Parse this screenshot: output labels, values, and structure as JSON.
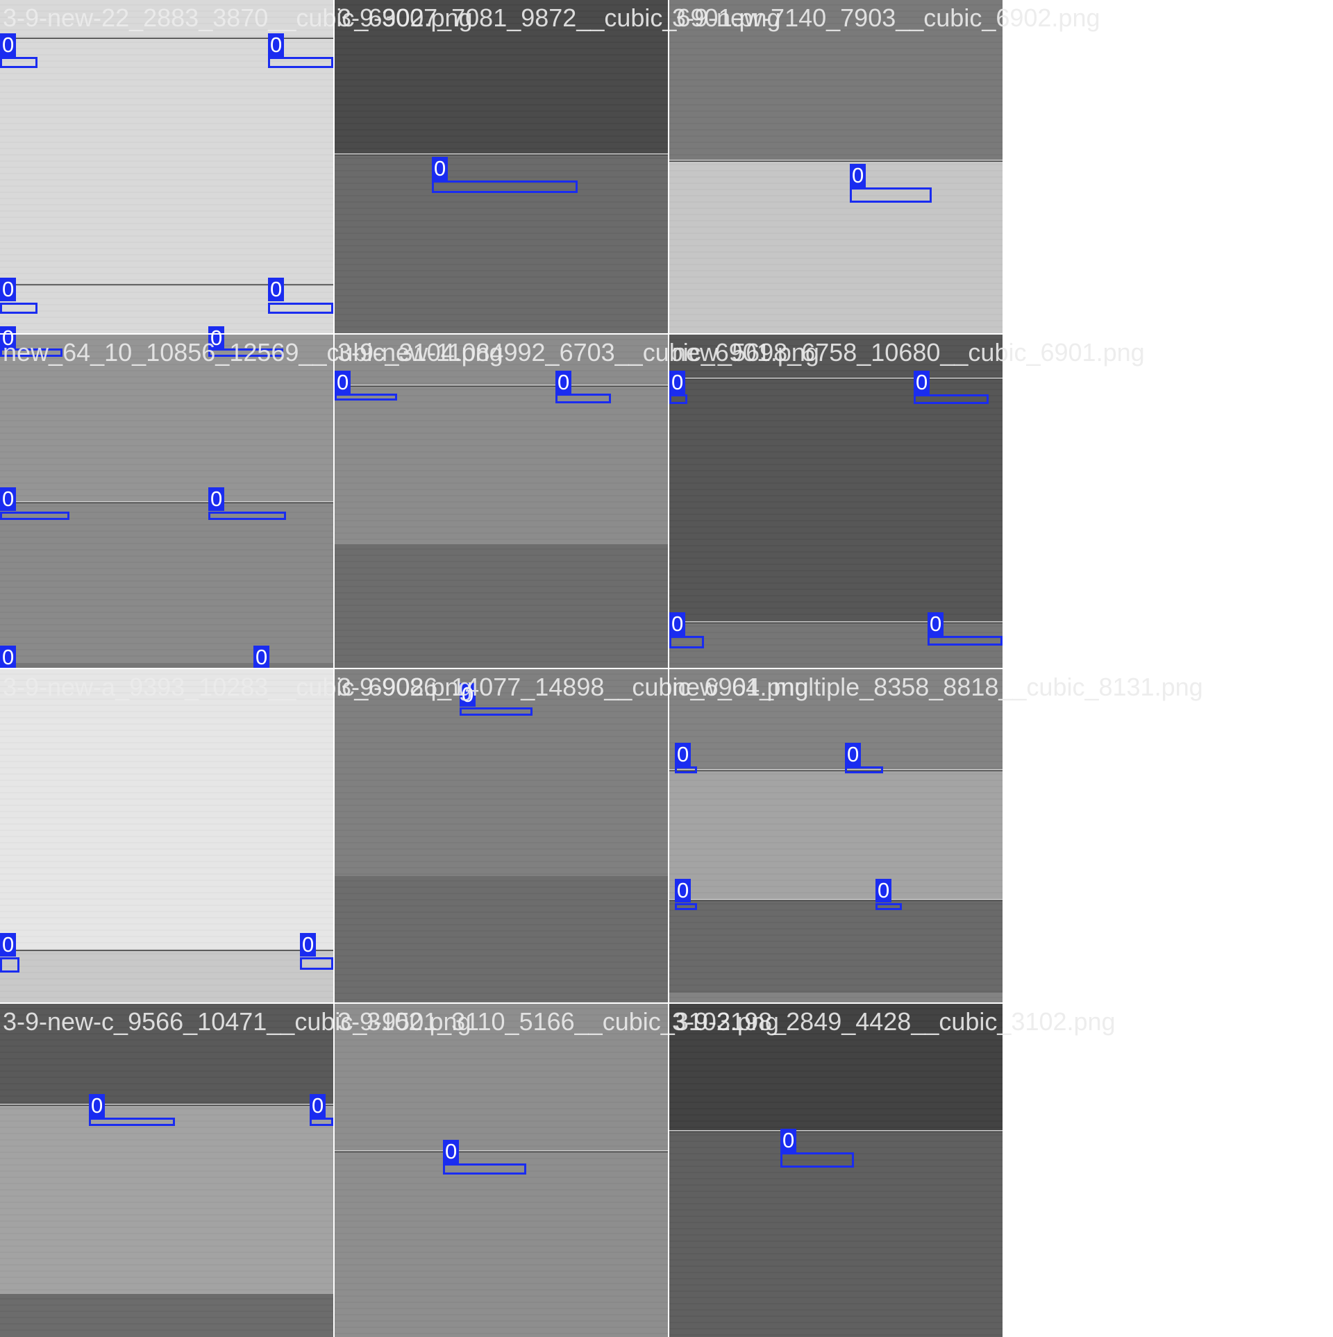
{
  "tiles": [
    {
      "file_label": "3-9-new-22_2883_3870__cubic_6902.png",
      "bands": [
        {
          "from": 0,
          "to": 1,
          "color": "#d9d9d9"
        }
      ],
      "edges": [
        0.11,
        0.85
      ],
      "class_labels": [
        "0",
        "0",
        "0",
        "0"
      ]
    },
    {
      "file_label": "3-9-3007_7081_9872__cubic_6901.png",
      "bands": [
        {
          "from": 0,
          "to": 0.46,
          "color": "#4b4b4b"
        },
        {
          "from": 0.46,
          "to": 1,
          "color": "#6b6b6b"
        }
      ],
      "edges": [
        0.46
      ],
      "class_labels": [
        "0"
      ]
    },
    {
      "file_label": "3-9-new-7140_7903__cubic_6902.png",
      "bands": [
        {
          "from": 0,
          "to": 0.48,
          "color": "#7a7a7a"
        },
        {
          "from": 0.48,
          "to": 1,
          "color": "#c6c6c6"
        }
      ],
      "edges": [
        0.48
      ],
      "class_labels": [
        "0"
      ]
    },
    {
      "file_label": "new_64_10_10856_12569__cubic_3104.png",
      "bands": [
        {
          "from": 0,
          "to": 0.5,
          "color": "#959595"
        },
        {
          "from": 0.5,
          "to": 0.985,
          "color": "#8a8a8a"
        },
        {
          "from": 0.985,
          "to": 1,
          "color": "#777777"
        }
      ],
      "edges": [
        0.5
      ],
      "class_labels": [
        "0",
        "0",
        "0",
        "0",
        "0",
        "0"
      ]
    },
    {
      "file_label": "3-9-new-11084992_6703__cubic_6901.png",
      "bands": [
        {
          "from": 0,
          "to": 0.63,
          "color": "#8c8c8c"
        },
        {
          "from": 0.63,
          "to": 1,
          "color": "#6d6d6d"
        }
      ],
      "edges": [
        0.15
      ],
      "class_labels": [
        "0",
        "0"
      ]
    },
    {
      "file_label": "new_5698_6758_10680__cubic_6901.png",
      "bands": [
        {
          "from": 0,
          "to": 0.86,
          "color": "#575757"
        },
        {
          "from": 0.86,
          "to": 1,
          "color": "#767676"
        }
      ],
      "edges": [
        0.13,
        0.86
      ],
      "class_labels": [
        "0",
        "0",
        "0",
        "0"
      ]
    },
    {
      "file_label": "3-9-new-a_9393_10283__cubic_6902.png",
      "bands": [
        {
          "from": 0,
          "to": 0.84,
          "color": "#e6e6e6"
        },
        {
          "from": 0.84,
          "to": 1,
          "color": "#c9c9c9"
        }
      ],
      "edges": [
        0.84
      ],
      "class_labels": [
        "0",
        "0"
      ]
    },
    {
      "file_label": "3-9-9086_14077_14898__cubic_6901.png",
      "bands": [
        {
          "from": 0,
          "to": 0.62,
          "color": "#808080"
        },
        {
          "from": 0.62,
          "to": 1,
          "color": "#6d6d6d"
        }
      ],
      "edges": [],
      "class_labels": [
        "0"
      ]
    },
    {
      "file_label": "new_64_multiple_8358_8818__cubic_8131.png",
      "bands": [
        {
          "from": 0,
          "to": 0.3,
          "color": "#838383"
        },
        {
          "from": 0.3,
          "to": 0.69,
          "color": "#a4a4a4"
        },
        {
          "from": 0.69,
          "to": 0.97,
          "color": "#6a6a6a"
        },
        {
          "from": 0.97,
          "to": 1,
          "color": "#838383"
        }
      ],
      "edges": [
        0.3,
        0.69
      ],
      "class_labels": [
        "0",
        "0",
        "0",
        "0"
      ]
    },
    {
      "file_label": "3-9-new-c_9566_10471__cubic_3102.png",
      "bands": [
        {
          "from": 0,
          "to": 0.3,
          "color": "#5a5a5a"
        },
        {
          "from": 0.3,
          "to": 0.87,
          "color": "#a3a3a3"
        },
        {
          "from": 0.87,
          "to": 1,
          "color": "#6c6c6c"
        }
      ],
      "edges": [
        0.3
      ],
      "class_labels": [
        "0",
        "0"
      ]
    },
    {
      "file_label": "3-9-9501_3110_5166__cubic_3102.png",
      "bands": [
        {
          "from": 0,
          "to": 1,
          "color": "#8e8e8e"
        }
      ],
      "edges": [
        0.44
      ],
      "class_labels": [
        "0"
      ]
    },
    {
      "file_label": "3-9-3198_2849_4428__cubic_3102.png",
      "bands": [
        {
          "from": 0,
          "to": 0.38,
          "color": "#434343"
        },
        {
          "from": 0.38,
          "to": 1,
          "color": "#606060"
        }
      ],
      "edges": [
        0.38
      ],
      "class_labels": [
        "0"
      ]
    }
  ]
}
